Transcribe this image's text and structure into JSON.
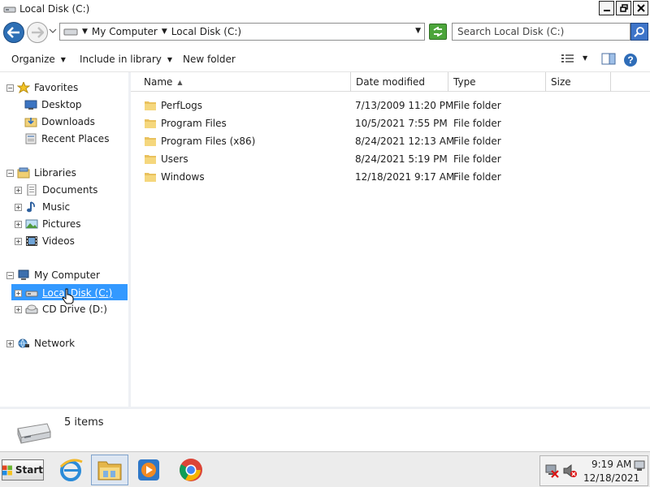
{
  "window": {
    "title": "Local Disk (C:)"
  },
  "address": {
    "crumbs": [
      "My Computer",
      "Local Disk (C:)"
    ],
    "search_placeholder": "Search Local Disk (C:)"
  },
  "toolbar": {
    "organize": "Organize",
    "include_in_library": "Include in library",
    "new_folder": "New folder"
  },
  "nav": {
    "favorites": {
      "label": "Favorites",
      "items": [
        "Desktop",
        "Downloads",
        "Recent Places"
      ]
    },
    "libraries": {
      "label": "Libraries",
      "items": [
        "Documents",
        "Music",
        "Pictures",
        "Videos"
      ]
    },
    "computer": {
      "label": "My Computer",
      "items": [
        "Local Disk (C:)",
        "CD Drive (D:)"
      ]
    },
    "network": {
      "label": "Network"
    }
  },
  "columns": [
    "Name",
    "Date modified",
    "Type",
    "Size"
  ],
  "files": [
    {
      "name": "PerfLogs",
      "date": "7/13/2009 11:20 PM",
      "type": "File folder"
    },
    {
      "name": "Program Files",
      "date": "10/5/2021 7:55 PM",
      "type": "File folder"
    },
    {
      "name": "Program Files (x86)",
      "date": "8/24/2021 12:13 AM",
      "type": "File folder"
    },
    {
      "name": "Users",
      "date": "8/24/2021 5:19 PM",
      "type": "File folder"
    },
    {
      "name": "Windows",
      "date": "12/18/2021 9:17 AM",
      "type": "File folder"
    }
  ],
  "details": {
    "count": "5 items"
  },
  "taskbar": {
    "start": "Start",
    "apps": [
      "internet-explorer-icon",
      "windows-explorer-icon",
      "media-player-icon",
      "chrome-icon"
    ],
    "time": "9:19 AM",
    "date": "12/18/2021"
  },
  "colors": {
    "selection": "#3399ff",
    "accent": "#2d6fb5"
  }
}
